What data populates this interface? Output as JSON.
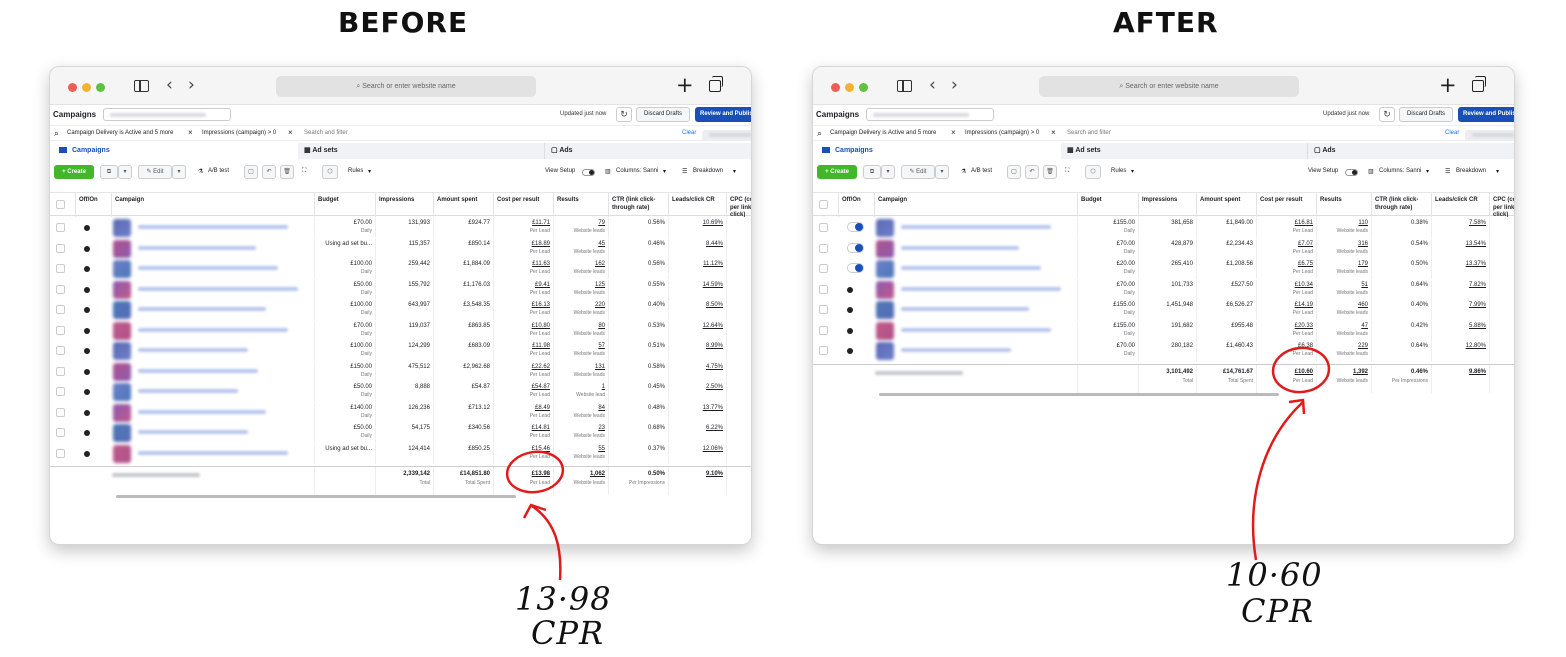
{
  "headings": {
    "before": "BEFORE",
    "after": "AFTER"
  },
  "browser": {
    "address_placeholder": "Search or enter website name"
  },
  "ads_manager": {
    "title": "Campaigns",
    "updated": "Updated just now",
    "discard": "Discard Drafts",
    "review": "Review and Publish",
    "filter1": "Campaign Delivery is Active and 5 more",
    "filter2": "Impressions (campaign) > 0",
    "search_filter": "Search and filter",
    "clear": "Clear",
    "tab_campaigns": "Campaigns",
    "tab_adsets": "Ad sets",
    "tab_ads": "Ads",
    "create": "+ Create",
    "edit": "Edit",
    "ab_test": "A/B test",
    "rules": "Rules",
    "view_setup": "View Setup",
    "columns": "Columns: Sanni",
    "breakdown": "Breakdown"
  },
  "columns": {
    "offon": "Off/On",
    "campaign": "Campaign",
    "budget": "Budget",
    "impressions": "Impressions",
    "spent": "Amount spent",
    "cpr": "Cost per result",
    "results": "Results",
    "ctr": "CTR (link click-through rate)",
    "lcr": "Leads/click CR",
    "cpc": "CPC (cost per link click)"
  },
  "labels": {
    "daily": "Daily",
    "per_lead": "Per Lead",
    "website_leads": "Website leads",
    "website_lead": "Website lead",
    "total": "Total",
    "total_spent": "Total Spent",
    "per_impressions": "Per Impressions"
  },
  "before": {
    "rows": [
      {
        "budget": "£70.00",
        "daily": true,
        "impr": "131,993",
        "spent": "£924.77",
        "cpr": "£11.71",
        "results": "79",
        "ctr": "0.56%",
        "lcr": "10.69%"
      },
      {
        "budget": "Using ad set bu...",
        "daily": false,
        "impr": "115,357",
        "spent": "£850.14",
        "cpr": "£18.89",
        "results": "45",
        "ctr": "0.46%",
        "lcr": "8.44%"
      },
      {
        "budget": "£100.00",
        "daily": true,
        "impr": "259,442",
        "spent": "£1,884.09",
        "cpr": "£11.63",
        "results": "162",
        "ctr": "0.56%",
        "lcr": "11.12%"
      },
      {
        "budget": "£50.00",
        "daily": true,
        "impr": "155,792",
        "spent": "£1,176.03",
        "cpr": "£9.41",
        "results": "125",
        "ctr": "0.55%",
        "lcr": "14.59%"
      },
      {
        "budget": "£100.00",
        "daily": true,
        "impr": "643,997",
        "spent": "£3,548.35",
        "cpr": "£16.13",
        "results": "220",
        "ctr": "0.40%",
        "lcr": "8.50%"
      },
      {
        "budget": "£70.00",
        "daily": true,
        "impr": "119,037",
        "spent": "£863.85",
        "cpr": "£10.80",
        "results": "80",
        "ctr": "0.53%",
        "lcr": "12.64%"
      },
      {
        "budget": "£100.00",
        "daily": true,
        "impr": "124,299",
        "spent": "£683.09",
        "cpr": "£11.98",
        "results": "57",
        "ctr": "0.51%",
        "lcr": "8.99%"
      },
      {
        "budget": "£150.00",
        "daily": true,
        "impr": "475,512",
        "spent": "£2,962.68",
        "cpr": "£22.62",
        "results": "131",
        "ctr": "0.58%",
        "lcr": "4.75%"
      },
      {
        "budget": "£50.00",
        "daily": true,
        "impr": "8,888",
        "spent": "£54.87",
        "cpr": "£54.87",
        "results": "1",
        "ctr": "0.45%",
        "lcr": "2.50%",
        "single": true
      },
      {
        "budget": "£140.00",
        "daily": true,
        "impr": "126,236",
        "spent": "£713.12",
        "cpr": "£8.49",
        "results": "84",
        "ctr": "0.48%",
        "lcr": "13.77%"
      },
      {
        "budget": "£50.00",
        "daily": true,
        "impr": "54,175",
        "spent": "£340.56",
        "cpr": "£14.81",
        "results": "23",
        "ctr": "0.68%",
        "lcr": "6.22%"
      },
      {
        "budget": "Using ad set bu...",
        "daily": false,
        "impr": "124,414",
        "spent": "£850.25",
        "cpr": "£15.46",
        "results": "55",
        "ctr": "0.37%",
        "lcr": "12.06%"
      }
    ],
    "totals": {
      "impr": "2,339,142",
      "spent": "£14,851.80",
      "cpr": "£13.98",
      "results": "1,062",
      "ctr": "0.50%",
      "lcr": "9.10%"
    },
    "annotation_value": "13·98",
    "annotation_label": "CPR"
  },
  "after": {
    "rows": [
      {
        "budget": "£155.00",
        "impr": "381,658",
        "spent": "£1,849.00",
        "cpr": "£16.81",
        "results": "110",
        "ctr": "0.38%",
        "lcr": "7.58%",
        "toggle": "blue"
      },
      {
        "budget": "£70.00",
        "impr": "428,879",
        "spent": "£2,234.43",
        "cpr": "£7.07",
        "results": "316",
        "ctr": "0.54%",
        "lcr": "13.54%",
        "toggle": "blue"
      },
      {
        "budget": "£20.00",
        "impr": "265,410",
        "spent": "£1,208.56",
        "cpr": "£6.75",
        "results": "179",
        "ctr": "0.50%",
        "lcr": "13.37%",
        "toggle": "blue"
      },
      {
        "budget": "£70.00",
        "impr": "101,733",
        "spent": "£527.50",
        "cpr": "£10.34",
        "results": "51",
        "ctr": "0.64%",
        "lcr": "7.82%",
        "toggle": "dot"
      },
      {
        "budget": "£155.00",
        "impr": "1,451,948",
        "spent": "£6,526.27",
        "cpr": "£14.19",
        "results": "460",
        "ctr": "0.40%",
        "lcr": "7.99%",
        "toggle": "dot"
      },
      {
        "budget": "£155.00",
        "impr": "191,682",
        "spent": "£955.48",
        "cpr": "£20.33",
        "results": "47",
        "ctr": "0.42%",
        "lcr": "5.88%",
        "toggle": "dot"
      },
      {
        "budget": "£70.00",
        "impr": "280,182",
        "spent": "£1,460.43",
        "cpr": "£6.38",
        "results": "229",
        "ctr": "0.64%",
        "lcr": "12.80%",
        "toggle": "dot"
      }
    ],
    "totals": {
      "impr": "3,101,492",
      "spent": "£14,761.67",
      "cpr": "£10.60",
      "results": "1,392",
      "ctr": "0.46%",
      "lcr": "9.86%"
    },
    "annotation_value": "10·60",
    "annotation_label": "CPR"
  },
  "colors": {
    "fb_blue": "#1b4fb8",
    "create_green": "#42b72a",
    "annotation_red": "#e01b1b"
  }
}
